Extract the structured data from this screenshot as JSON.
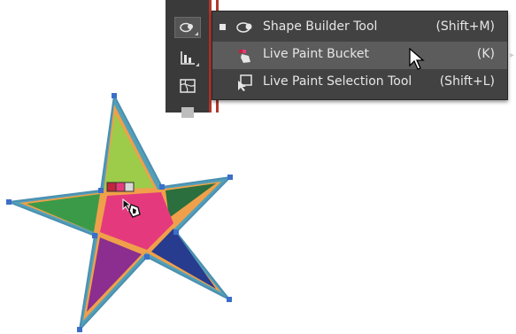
{
  "flyout_menu": {
    "items": [
      {
        "label": "Shape Builder Tool",
        "shortcut": "(Shift+M)",
        "icon": "shape-builder-icon",
        "selected": true
      },
      {
        "label": "Live Paint Bucket",
        "shortcut": "(K)",
        "icon": "live-paint-bucket-icon",
        "hovered": true
      },
      {
        "label": "Live Paint Selection Tool",
        "shortcut": "(Shift+L)",
        "icon": "live-paint-selection-icon"
      }
    ]
  },
  "toolbar": {
    "tools": [
      "shape-builder-icon",
      "chart-icon",
      "mesh-icon",
      "gradient-icon"
    ]
  },
  "star_colors": {
    "top": "#9ccc4a",
    "left": "#3b9a48",
    "center": "#e43a7d",
    "right": "#2a6f3d",
    "bottom_left": "#8b2e8f",
    "bottom_right": "#273b8f",
    "edge": "#f0a04a",
    "outline": "#52a0b8"
  },
  "swatch_colors": [
    "#c0253c",
    "#e43a7d",
    "#d9d9d9"
  ]
}
